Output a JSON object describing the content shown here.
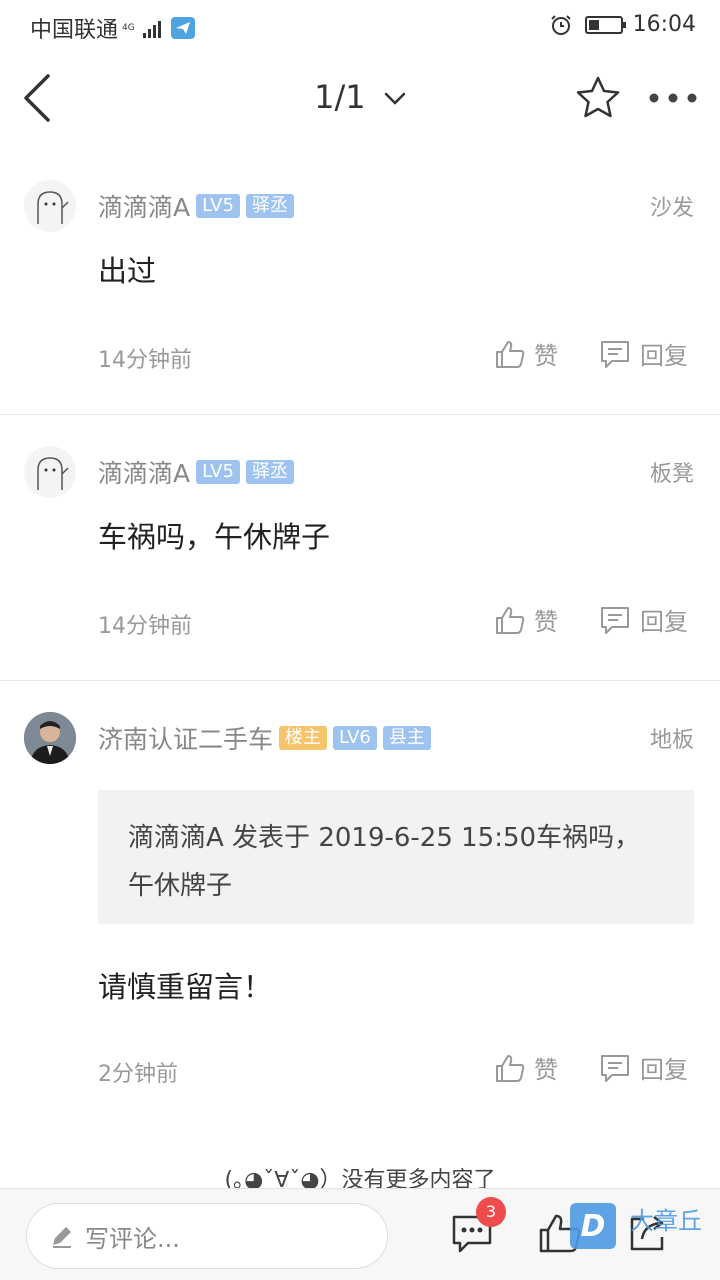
{
  "status_bar": {
    "carrier": "中国联通",
    "network": "4G",
    "time": "16:04",
    "battery_level": 0.35
  },
  "nav": {
    "title": "1/1"
  },
  "posts": [
    {
      "username": "滴滴滴A",
      "level": "LV5",
      "title_badge": "驿丞",
      "floor": "沙发",
      "content": "出过",
      "time": "14分钟前",
      "like_label": "赞",
      "reply_label": "回复"
    },
    {
      "username": "滴滴滴A",
      "level": "LV5",
      "title_badge": "驿丞",
      "floor": "板凳",
      "content": "车祸吗，午休牌子",
      "time": "14分钟前",
      "like_label": "赞",
      "reply_label": "回复"
    },
    {
      "username": "济南认证二手车",
      "owner_badge": "楼主",
      "level": "LV6",
      "title_badge": "县主",
      "floor": "地板",
      "quote": "滴滴滴A 发表于 2019-6-25 15:50车祸吗，午休牌子",
      "content": "请慎重留言！",
      "time": "2分钟前",
      "like_label": "赞",
      "reply_label": "回复"
    }
  ],
  "end_text": "(｡◕ˇ∀ˇ◕）没有更多内容了",
  "bottom_bar": {
    "comment_placeholder": "写评论...",
    "comment_count": "3"
  },
  "watermark": {
    "logo": "D",
    "text": "大章丘"
  },
  "colors": {
    "badge_blue": "#9ec3ee",
    "badge_gold": "#f5c46b",
    "notify_red": "#f04b4b"
  }
}
